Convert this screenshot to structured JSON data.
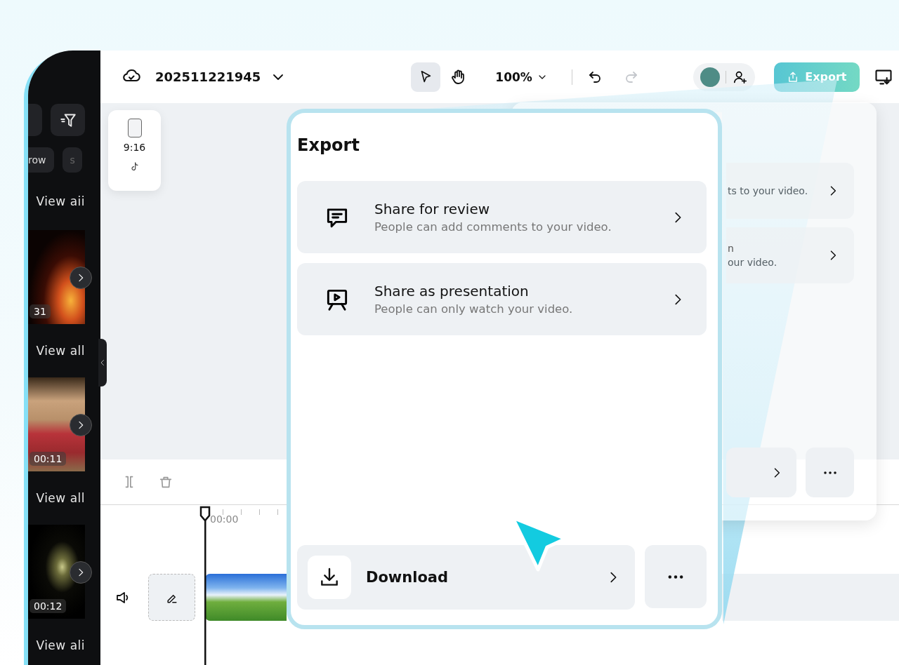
{
  "project": {
    "title": "202511221945"
  },
  "toolbar": {
    "tools": [
      {
        "kind": "select",
        "selected": true
      },
      {
        "kind": "hand",
        "selected": false
      }
    ],
    "zoom": "100%",
    "undo_disabled": false,
    "redo_disabled": true
  },
  "export_button": {
    "label": "Export"
  },
  "sidebar": {
    "chips": [
      "row",
      "s"
    ],
    "sections": [
      {
        "link": "View aii",
        "clip": {
          "kind": "fire",
          "duration": "31"
        }
      },
      {
        "link": "View all",
        "clip": {
          "kind": "gift",
          "duration": "00:11"
        }
      },
      {
        "link": "View all",
        "clip": {
          "kind": "dust",
          "duration": "00:12"
        }
      },
      {
        "link": "View ali"
      }
    ]
  },
  "aspect": {
    "ratio": "9:16"
  },
  "timeline": {
    "timecode": "00:00"
  },
  "back_panel": {
    "options": [
      {
        "subtitle": "ts to your video."
      },
      {
        "title": "n",
        "subtitle": "our video."
      }
    ]
  },
  "export_panel": {
    "title": "Export",
    "options": [
      {
        "kind": "review",
        "title": "Share for review",
        "subtitle": "People can add comments to your video."
      },
      {
        "kind": "presentation",
        "title": "Share as presentation",
        "subtitle": "People can only watch your video."
      }
    ],
    "download": {
      "label": "Download"
    }
  }
}
